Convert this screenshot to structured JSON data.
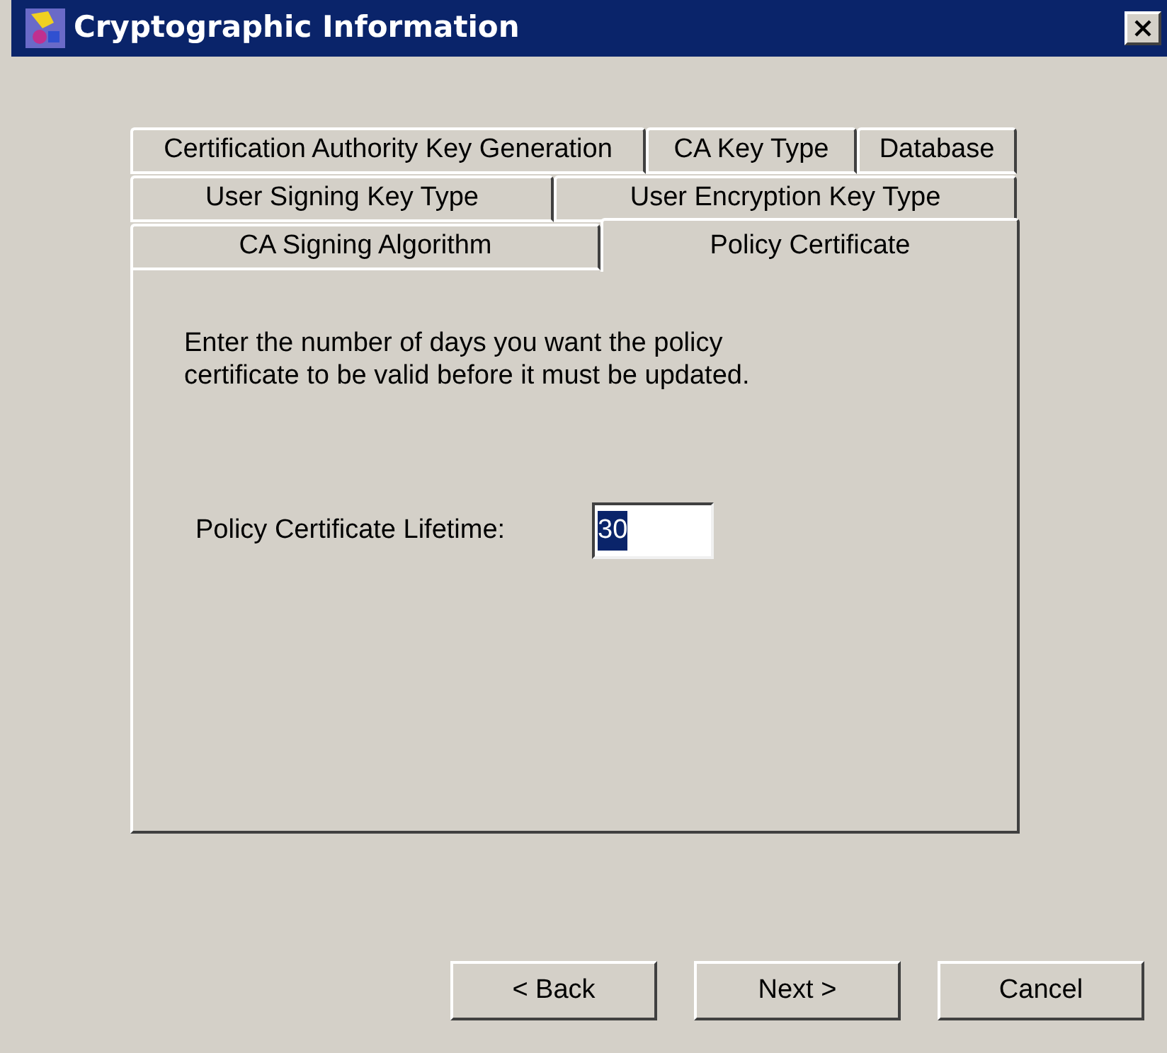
{
  "window": {
    "title": "Cryptographic Information"
  },
  "tab_rows": [
    [
      {
        "label": "Certification Authority Key Generation",
        "selected": false
      },
      {
        "label": "CA Key Type",
        "selected": false
      },
      {
        "label": "Database",
        "selected": false
      }
    ],
    [
      {
        "label": "User Signing Key Type",
        "selected": false
      },
      {
        "label": "User Encryption Key Type",
        "selected": false
      }
    ],
    [
      {
        "label": "CA Signing Algorithm",
        "selected": false
      },
      {
        "label": "Policy Certificate",
        "selected": true
      }
    ]
  ],
  "instructions": "Enter the number of days you want the policy certificate to be valid before it must be updated.",
  "lifetime_field": {
    "label": "Policy Certificate Lifetime:",
    "value": "30",
    "text_selected": true
  },
  "buttons": [
    "< Back",
    "Next >",
    "Cancel"
  ]
}
